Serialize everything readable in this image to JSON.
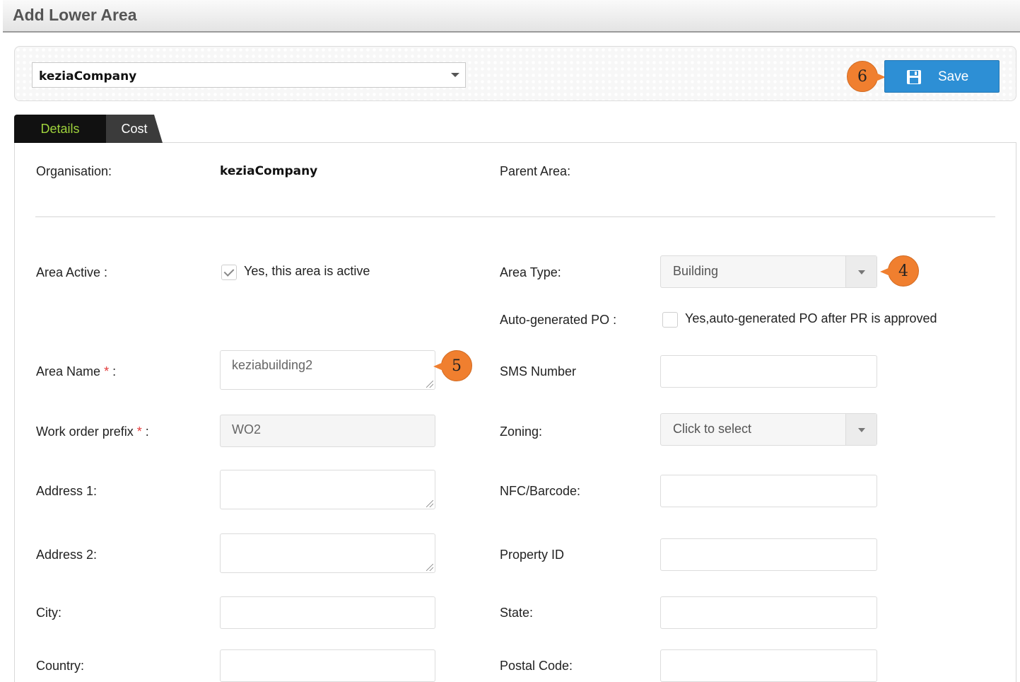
{
  "page": {
    "title": "Add Lower Area"
  },
  "toolbar": {
    "organisation_value": "keziaCompany",
    "save_label": "Save",
    "save_callout": "6"
  },
  "tabs": [
    {
      "label": "Details",
      "active": true
    },
    {
      "label": "Cost",
      "active": false
    }
  ],
  "details": {
    "organisation_label": "Organisation:",
    "organisation_value": "keziaCompany",
    "parent_area_label": "Parent Area:",
    "area_active_label": "Area Active :",
    "area_active_checked": true,
    "area_active_text": "Yes, this area is active",
    "area_type_label": "Area Type:",
    "area_type_value": "Building",
    "area_type_callout": "4",
    "auto_po_label": "Auto-generated PO :",
    "auto_po_checked": false,
    "auto_po_text": "Yes,auto-generated PO after PR is approved",
    "area_name_label": "Area Name",
    "area_name_value": "keziabuilding2",
    "area_name_callout": "5",
    "sms_label": "SMS Number",
    "sms_value": "",
    "wo_prefix_label": "Work order prefix",
    "wo_prefix_value": "WO2",
    "zoning_label": "Zoning:",
    "zoning_value": "Click to select",
    "address1_label": "Address 1:",
    "address1_value": "",
    "nfc_label": "NFC/Barcode:",
    "nfc_value": "",
    "address2_label": "Address 2:",
    "address2_value": "",
    "property_id_label": "Property ID",
    "property_id_value": "",
    "city_label": "City:",
    "city_value": "",
    "state_label": "State:",
    "state_value": "",
    "country_label": "Country:",
    "country_value": "",
    "postal_label": "Postal Code:",
    "postal_value": "",
    "required_mark": "*",
    "required_suffix": " :"
  },
  "colors": {
    "accent": "#2d8fd5",
    "callout": "#f07f2f",
    "active_tab_text": "#9fd33c",
    "required": "#e23b3b"
  },
  "icons": {
    "save": "floppy-disk-icon",
    "dropdown": "caret-down-icon",
    "check": "check-icon"
  }
}
